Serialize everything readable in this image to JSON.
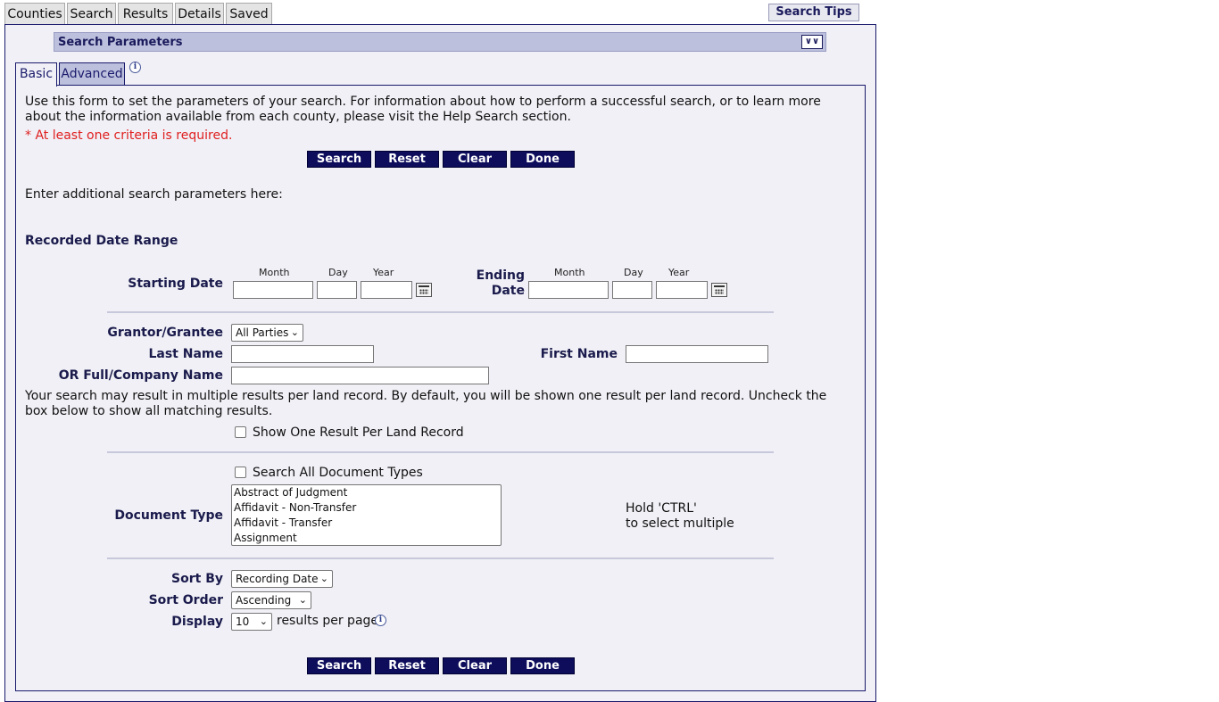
{
  "top_tabs": [
    "Counties",
    "Search",
    "Results",
    "Details",
    "Saved"
  ],
  "search_tips_label": "Search Tips",
  "section_title": "Search Parameters",
  "collapse_icon": "double-chevron-down-icon",
  "inner_tabs": {
    "basic": "Basic",
    "advanced": "Advanced"
  },
  "intro_text": "Use this form to set the parameters of your search. For information about how to perform a successful search, or to learn more about the information available from each county, please visit the Help Search section.",
  "required_note": "* At least one criteria is required.",
  "buttons": {
    "search": "Search",
    "reset": "Reset",
    "clear": "Clear",
    "done": "Done"
  },
  "additional_text": "Enter additional search parameters here:",
  "date_range_heading": "Recorded Date Range",
  "starting_date_label": "Starting Date",
  "ending_date_label": "Ending Date",
  "date_parts": {
    "month": "Month",
    "day": "Day",
    "year": "Year"
  },
  "grantor_label": "Grantor/Grantee",
  "grantor_selected": "All Parties",
  "last_name_label": "Last Name",
  "first_name_label": "First Name",
  "full_name_label": "OR Full/Company Name",
  "multi_result_note": "Your search may result in multiple results per land record. By default, you will be shown one result per land record. Uncheck the box below to show all matching results.",
  "one_result_label": "Show One Result Per Land Record",
  "all_doc_types_label": "Search All Document Types",
  "document_type_label": "Document Type",
  "document_types": [
    "Abstract of Judgment",
    "Affidavit - Non-Transfer",
    "Affidavit - Transfer",
    "Assignment"
  ],
  "ctrl_hint_line1": "Hold 'CTRL'",
  "ctrl_hint_line2": "to select multiple",
  "sort_by_label": "Sort By",
  "sort_by_selected": "Recording Date",
  "sort_order_label": "Sort Order",
  "sort_order_selected": "Ascending",
  "display_label": "Display",
  "display_selected": "10",
  "results_per_page": "results per page",
  "info_icon_glyph": "i",
  "colors": {
    "panel_bg": "#f0f0f6",
    "navy": "#0d0d5c",
    "section_bar": "#bcc0dc",
    "required": "#e02020"
  }
}
